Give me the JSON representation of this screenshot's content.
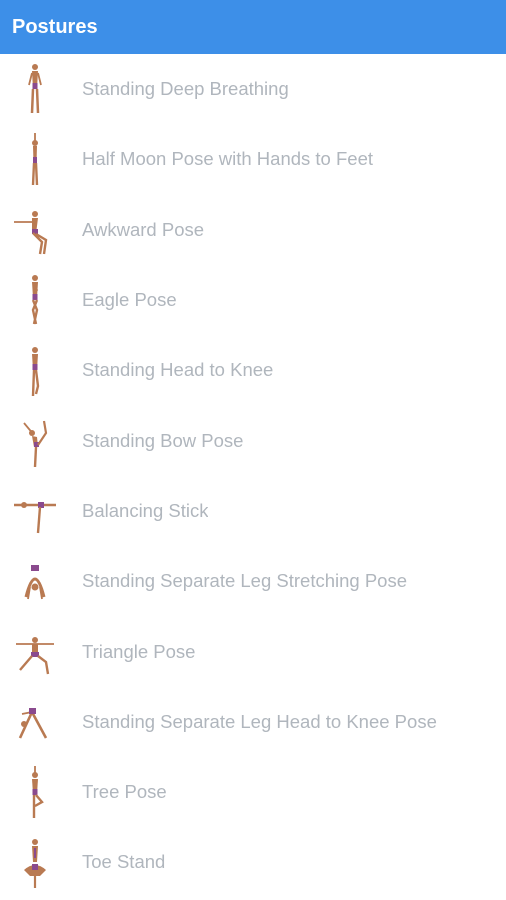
{
  "appbar": {
    "title": "Postures"
  },
  "colors": {
    "appbar_bg": "#3d8fe8",
    "appbar_text": "#ffffff",
    "item_text": "#b0b6bd",
    "skin": "#b97a52",
    "outfit": "#8a4a8e"
  },
  "postures": [
    {
      "label": "Standing Deep Breathing",
      "icon": "standing-deep-breathing-figure"
    },
    {
      "label": "Half Moon Pose with Hands to Feet",
      "icon": "half-moon-figure"
    },
    {
      "label": "Awkward Pose",
      "icon": "awkward-pose-figure"
    },
    {
      "label": "Eagle Pose",
      "icon": "eagle-pose-figure"
    },
    {
      "label": "Standing Head to Knee",
      "icon": "standing-head-to-knee-figure"
    },
    {
      "label": "Standing Bow Pose",
      "icon": "standing-bow-figure"
    },
    {
      "label": "Balancing Stick",
      "icon": "balancing-stick-figure"
    },
    {
      "label": "Standing Separate Leg Stretching Pose",
      "icon": "separate-leg-stretching-figure"
    },
    {
      "label": "Triangle Pose",
      "icon": "triangle-pose-figure"
    },
    {
      "label": "Standing Separate Leg Head to Knee Pose",
      "icon": "separate-leg-head-to-knee-figure"
    },
    {
      "label": "Tree Pose",
      "icon": "tree-pose-figure"
    },
    {
      "label": "Toe Stand",
      "icon": "toe-stand-figure"
    }
  ]
}
